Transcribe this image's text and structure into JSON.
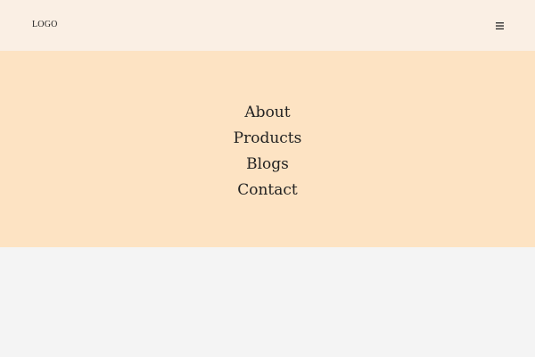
{
  "header": {
    "logo_text": "LOGO",
    "menu_icon": "hamburger-menu-icon"
  },
  "menu": {
    "items": [
      {
        "label": "About"
      },
      {
        "label": "Products"
      },
      {
        "label": "Blogs"
      },
      {
        "label": "Contact"
      }
    ]
  },
  "colors": {
    "header_background": "#faefe4",
    "menu_background": "#fde3c3",
    "page_background": "#f4f4f4",
    "text": "#222222"
  }
}
